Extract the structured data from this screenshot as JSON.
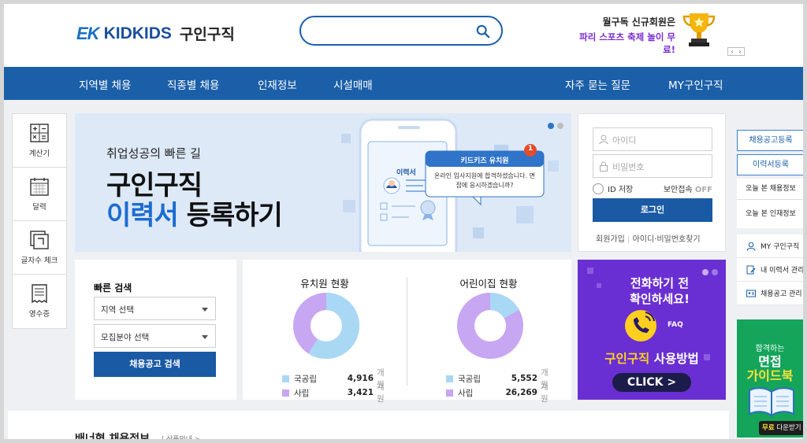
{
  "header": {
    "logo_ek": "EK",
    "logo_kidkids": "KIDKIDS",
    "logo_kr": "구인구직",
    "search_placeholder": "",
    "promo_line1": "월구독 신규회원은",
    "promo_line2": "파리 스포츠 축제 놀이 무료!",
    "pager_prev": "‹",
    "pager_next": "›"
  },
  "nav": {
    "items": [
      {
        "label": "지역별 채용"
      },
      {
        "label": "직종별 채용"
      },
      {
        "label": "인재정보"
      },
      {
        "label": "시설매매"
      },
      {
        "label": "자주 묻는 질문"
      },
      {
        "label": "MY구인구직"
      }
    ]
  },
  "sidetools": [
    {
      "label": "계산기",
      "icon": "calculator-icon"
    },
    {
      "label": "달력",
      "icon": "calendar-icon"
    },
    {
      "label": "글자수 체크",
      "icon": "text-count-icon"
    },
    {
      "label": "영수증",
      "icon": "receipt-icon"
    }
  ],
  "banner": {
    "subtitle": "취업성공의 빠른 길",
    "title1": "구인구직",
    "title2_highlight": "이력서",
    "title2_rest": " 등록하기",
    "card_title": "이력서",
    "popup_title": "키드키즈 유치원",
    "popup_badge": "1",
    "popup_text": "온라인 입사지원에 합격하셨습니다. 면접에 응시하겠습니까?"
  },
  "login": {
    "id_placeholder": "아이디",
    "pw_placeholder": "비밀번호",
    "id_save": "ID 저장",
    "secure": "보안접속",
    "secure_state": "OFF",
    "login_button": "로그인",
    "join": "회원가입",
    "find": "아이디·비밀번호찾기"
  },
  "right": {
    "post_job": "채용공고등록",
    "post_resume": "이력서등록",
    "viewed_jobs": "오늘 본 채용정보",
    "viewed_talent": "오늘 본 인재정보",
    "my_jobs": "MY 구인구직",
    "my_resume": "내 이력서 관리",
    "job_manage": "채용공고 관리"
  },
  "quick": {
    "title": "빠른 검색",
    "region": "지역 선택",
    "field": "모집분야 선택",
    "button": "채용공고 검색"
  },
  "stats": [
    {
      "title": "유치원 현황",
      "rows": [
        {
          "label": "국공립",
          "value": "4,916",
          "unit": "개 원"
        },
        {
          "label": "사립",
          "value": "3,421",
          "unit": "개 원"
        }
      ],
      "public_share": 0.59
    },
    {
      "title": "어린이집 현황",
      "rows": [
        {
          "label": "국공립",
          "value": "5,552",
          "unit": "개 원"
        },
        {
          "label": "사립",
          "value": "26,269",
          "unit": "개 원"
        }
      ],
      "public_share": 0.17
    }
  ],
  "colors": {
    "public": "#a9d8f5",
    "private": "#c7a6f2",
    "brand": "#1b5fa9"
  },
  "faq": {
    "line1": "전화하기 전",
    "line2": "확인하세요!",
    "tag": "FAQ",
    "title_highlight": "구인구직",
    "title_rest": " 사용방법",
    "click": "CLICK >"
  },
  "guide": {
    "line1": "합격하는",
    "line2": "면접",
    "line3": "가이드북",
    "free": "무료",
    "download": " 다운받기"
  },
  "bottom": {
    "title": "배너형 채용정보",
    "more": "| 상품안내 >"
  }
}
